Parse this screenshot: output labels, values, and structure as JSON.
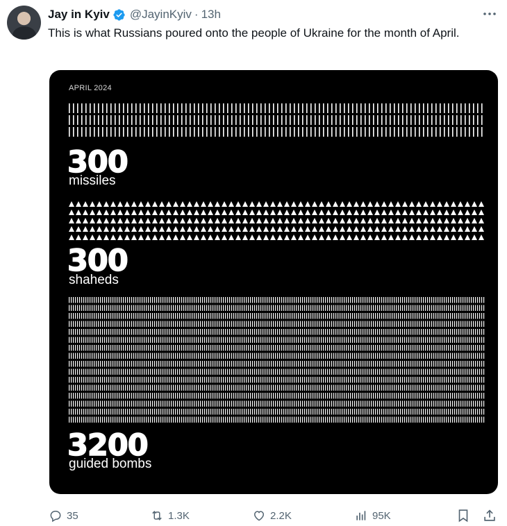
{
  "tweet": {
    "author_name": "Jay in Kyiv",
    "handle": "@JayinKyiv",
    "separator": "·",
    "time": "13h",
    "text": "This is what Russians poured onto the people of Ukraine for the month of April."
  },
  "infographic": {
    "period": "APRIL 2024",
    "sections": [
      {
        "count": "300",
        "label": "missiles",
        "icon": "missile-icon"
      },
      {
        "count": "300",
        "label": "shaheds",
        "icon": "drone-triangle-icon"
      },
      {
        "count": "3200",
        "label": "guided bombs",
        "icon": "bomb-bar-icon"
      }
    ]
  },
  "actions": {
    "replies": "35",
    "reposts": "1.3K",
    "likes": "2.2K",
    "views": "95K"
  },
  "colors": {
    "accent": "#1d9bf0",
    "muted": "#536471",
    "card": "#000000"
  }
}
